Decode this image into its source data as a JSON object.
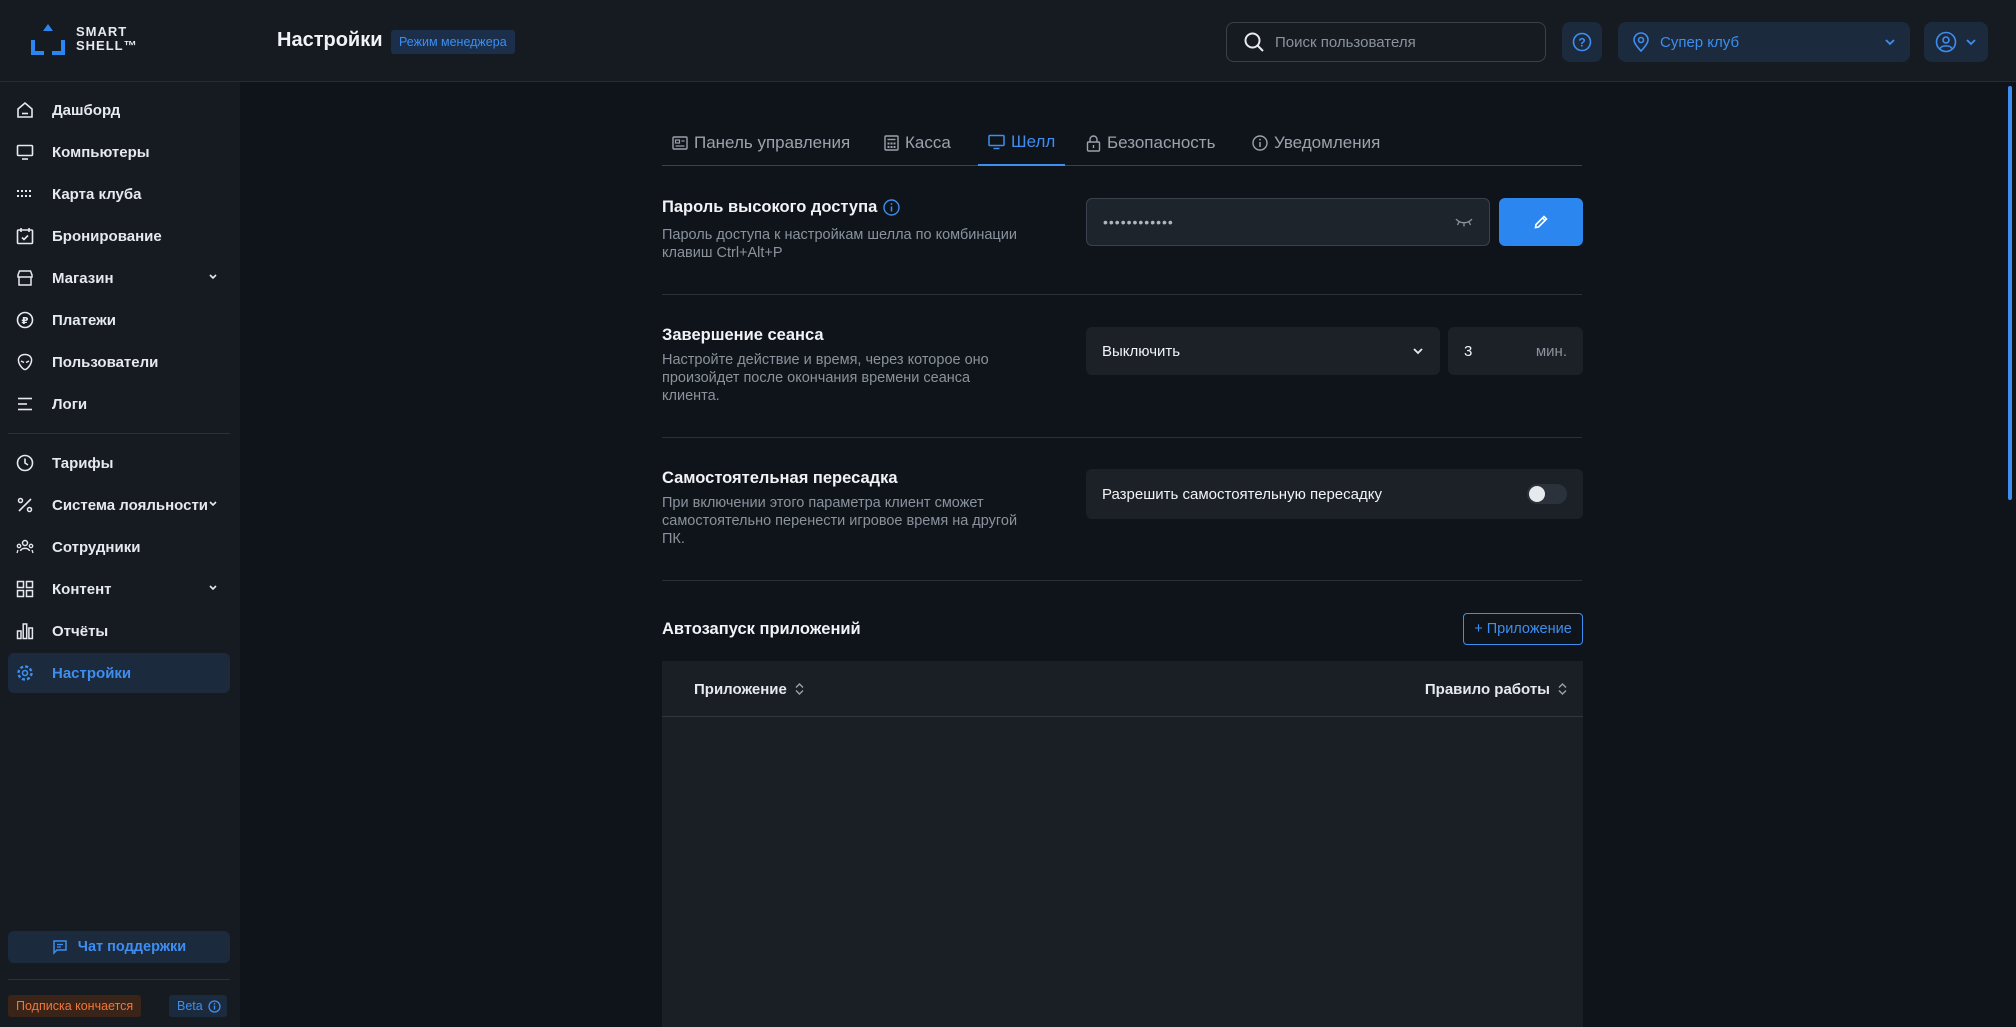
{
  "app": {
    "logo_line1": "SMART",
    "logo_line2": "SHELL™",
    "page_title": "Настройки",
    "mode_badge": "Режим менеджера"
  },
  "header": {
    "search_placeholder": "Поиск пользователя",
    "club_name": "Супер клуб",
    "icons": [
      "search-icon",
      "help-icon",
      "location-pin-icon",
      "chevron-down-icon",
      "user-circle-icon"
    ]
  },
  "sidebar": {
    "items": [
      {
        "label": "Дашборд",
        "icon": "home-icon"
      },
      {
        "label": "Компьютеры",
        "icon": "monitor-icon"
      },
      {
        "label": "Карта клуба",
        "icon": "grid-dots-icon"
      },
      {
        "label": "Бронирование",
        "icon": "calendar-check-icon"
      },
      {
        "label": "Магазин",
        "icon": "store-icon",
        "expandable": true
      },
      {
        "label": "Платежи",
        "icon": "ruble-icon"
      },
      {
        "label": "Пользователи",
        "icon": "alien-head-icon"
      },
      {
        "label": "Логи",
        "icon": "lines-icon"
      },
      {
        "label": "Тарифы",
        "icon": "clock-icon"
      },
      {
        "label": "Система лояльности",
        "icon": "percent-icon",
        "expandable": true
      },
      {
        "label": "Сотрудники",
        "icon": "users-icon"
      },
      {
        "label": "Контент",
        "icon": "apps-grid-icon",
        "expandable": true
      },
      {
        "label": "Отчёты",
        "icon": "bar-chart-icon"
      },
      {
        "label": "Настройки",
        "icon": "gear-icon",
        "active": true
      }
    ],
    "support_label": "Чат поддержки",
    "subscription_badge": "Подписка кончается",
    "beta_badge": "Beta"
  },
  "tabs": [
    {
      "label": "Панель управления",
      "icon": "dashboard-icon"
    },
    {
      "label": "Касса",
      "icon": "calculator-icon"
    },
    {
      "label": "Шелл",
      "icon": "monitor-icon",
      "active": true
    },
    {
      "label": "Безопасность",
      "icon": "lock-icon"
    },
    {
      "label": "Уведомления",
      "icon": "info-icon"
    }
  ],
  "sections": {
    "password": {
      "title": "Пароль высокого доступа",
      "description": "Пароль доступа к настройкам шелла по комбинации клавиш Ctrl+Alt+P",
      "masked_value": "••••••••••••"
    },
    "session_end": {
      "title": "Завершение сеанса",
      "description": "Настройте действие и время, через которое оно произойдет после окончания времени сеанса клиента.",
      "action_value": "Выключить",
      "minutes_value": "3",
      "minutes_unit": "мин."
    },
    "self_transfer": {
      "title": "Самостоятельная пересадка",
      "description": "При включении этого параметра клиент сможет самостоятельно перенести игровое время на другой ПК.",
      "toggle_label": "Разрешить самостоятельную пересадку",
      "toggle_on": false
    },
    "autostart": {
      "title": "Автозапуск приложений",
      "add_button": "+ Приложение",
      "columns": [
        "Приложение",
        "Правило работы"
      ],
      "rows": []
    }
  },
  "colors": {
    "accent": "#3d8ef0",
    "background": "#0f141a",
    "panel": "#161b22",
    "warning": "#f0763d"
  }
}
